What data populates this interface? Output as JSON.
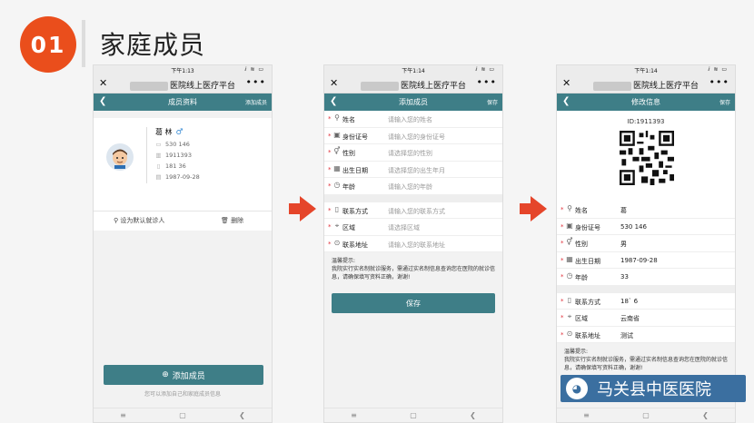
{
  "slide": {
    "number": "01",
    "title": "家庭成员"
  },
  "watermark": {
    "text": "马关县中医医院"
  },
  "phones": [
    {
      "status": {
        "time": "下午1:13",
        "icons": "ⅈ ≋ ▭"
      },
      "nav": {
        "close": "✕",
        "title": "医院线上医疗平台",
        "more": "•••"
      },
      "header": {
        "back": "❮",
        "title": "成员资料",
        "action": "添加成员"
      },
      "member": {
        "name": "葛 林",
        "gender_icon": "♂",
        "id_number": "530            146",
        "card_no": "1911393",
        "phone": "181           36",
        "birthday": "1987-09-28"
      },
      "actions": {
        "set_default": "设为默认就诊人",
        "delete": "删除"
      },
      "add_button": "添加成员",
      "hint": "您可以添加自己和家庭成员信息",
      "sysnav": [
        "≡",
        "▢",
        "❮"
      ]
    },
    {
      "status": {
        "time": "下午1:14",
        "icons": "ⅈ ≋ ▭"
      },
      "nav": {
        "close": "✕",
        "title": "医院线上医疗平台",
        "more": "•••"
      },
      "header": {
        "back": "❮",
        "title": "添加成员",
        "action": "保存"
      },
      "fields": [
        {
          "label": "姓名",
          "placeholder": "请输入您的姓名"
        },
        {
          "label": "身份证号",
          "placeholder": "请输入您的身份证号"
        },
        {
          "label": "性别",
          "placeholder": "请选择您的性别"
        },
        {
          "label": "出生日期",
          "placeholder": "请选择您的出生年月"
        },
        {
          "label": "年龄",
          "placeholder": "请输入您的年龄"
        }
      ],
      "contact_fields": [
        {
          "label": "联系方式",
          "placeholder": "请输入您的联系方式"
        },
        {
          "label": "区域",
          "placeholder": "请选择区域"
        },
        {
          "label": "联系地址",
          "placeholder": "请输入您的联系地址"
        }
      ],
      "tips_title": "温馨提示:",
      "tips_body": "我院实行实名制就诊服务，需通过实名制信息查询您在医院的就诊信息，请确保填写资料正确，谢谢!",
      "save_button": "保存",
      "sysnav": [
        "≡",
        "▢",
        "❮"
      ]
    },
    {
      "status": {
        "time": "下午1:14",
        "icons": "ⅈ ≋ ▭"
      },
      "nav": {
        "close": "✕",
        "title": "医院线上医疗平台",
        "more": "•••"
      },
      "header": {
        "back": "❮",
        "title": "修改信息",
        "action": "保存"
      },
      "id_label": "ID:1911393",
      "fields": [
        {
          "label": "姓名",
          "value": "葛"
        },
        {
          "label": "身份证号",
          "value": "530              146"
        },
        {
          "label": "性别",
          "value": "男"
        },
        {
          "label": "出生日期",
          "value": "1987-09-28"
        },
        {
          "label": "年龄",
          "value": "33"
        }
      ],
      "contact_fields": [
        {
          "label": "联系方式",
          "value": "18`          6"
        },
        {
          "label": "区域",
          "value": "云南省"
        },
        {
          "label": "联系地址",
          "value": "测试"
        }
      ],
      "tips_title": "温馨提示:",
      "tips_body": "我院实行实名制就诊服务，需通过实名制信息查询您在医院的就诊信息，请确保填写资料正确，谢谢!",
      "sysnav": [
        "≡",
        "▢",
        "❮"
      ]
    }
  ]
}
